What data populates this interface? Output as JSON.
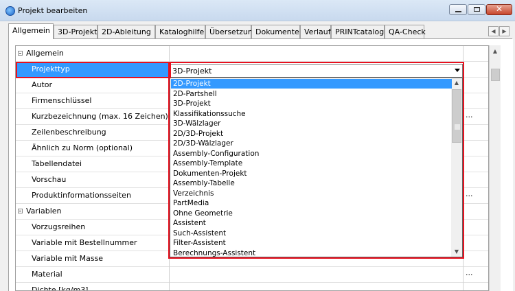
{
  "window": {
    "title": "Projekt bearbeiten",
    "close_glyph": "✕"
  },
  "tabs": [
    {
      "label": "Allgemein",
      "active": true
    },
    {
      "label": "3D-Projekt",
      "active": false
    },
    {
      "label": "2D-Ableitung",
      "active": false
    },
    {
      "label": "Kataloghilfe",
      "active": false
    },
    {
      "label": "Übersetzung",
      "active": false
    },
    {
      "label": "Dokumente",
      "active": false
    },
    {
      "label": "Verlauf",
      "active": false
    },
    {
      "label": "PRINTcatalog",
      "active": false
    },
    {
      "label": "QA-Check",
      "active": false
    }
  ],
  "tab_scroll": {
    "left_icon": "◀",
    "right_icon": "▶"
  },
  "grid": {
    "rows": [
      {
        "label": "Allgemein",
        "group": true
      },
      {
        "label": "Projekttyp",
        "selected": true,
        "value": "3D-Projekt"
      },
      {
        "label": "Autor"
      },
      {
        "label": "Firmenschlüssel"
      },
      {
        "label": "Kurzbezeichnung (max. 16 Zeichen)",
        "ellipsis": "..."
      },
      {
        "label": "Zeilenbeschreibung"
      },
      {
        "label": "Ähnlich zu Norm (optional)"
      },
      {
        "label": "Tabellendatei"
      },
      {
        "label": "Vorschau"
      },
      {
        "label": "Produktinformationsseiten",
        "ellipsis": "..."
      },
      {
        "label": "Variablen",
        "group": true
      },
      {
        "label": "Vorzugsreihen"
      },
      {
        "label": "Variable mit Bestellnummer"
      },
      {
        "label": "Variable mit Masse"
      },
      {
        "label": "Material",
        "ellipsis": "..."
      },
      {
        "label": "Dichte [kg/m3]"
      }
    ]
  },
  "dropdown": {
    "selected_value": "3D-Projekt",
    "options": [
      {
        "label": "2D-Projekt",
        "highlighted": true
      },
      {
        "label": "2D-Partshell"
      },
      {
        "label": "3D-Projekt"
      },
      {
        "label": "Klassifikationssuche"
      },
      {
        "label": "3D-Wälzlager"
      },
      {
        "label": "2D/3D-Projekt"
      },
      {
        "label": "2D/3D-Wälzlager"
      },
      {
        "label": "Assembly-Configuration"
      },
      {
        "label": "Assembly-Template"
      },
      {
        "label": "Dokumenten-Projekt"
      },
      {
        "label": "Assembly-Tabelle"
      },
      {
        "label": "Verzeichnis"
      },
      {
        "label": "PartMedia"
      },
      {
        "label": "Ohne Geometrie"
      },
      {
        "label": "Assistent"
      },
      {
        "label": "Such-Assistent"
      },
      {
        "label": "Filter-Assistent"
      },
      {
        "label": "Berechnungs-Assistent"
      }
    ],
    "scroll_up_icon": "▲",
    "scroll_down_icon": "▼"
  },
  "scrollbar": {
    "up_icon": "▲"
  },
  "colors": {
    "highlight": "#3399ff",
    "annotation": "#e8101e"
  }
}
